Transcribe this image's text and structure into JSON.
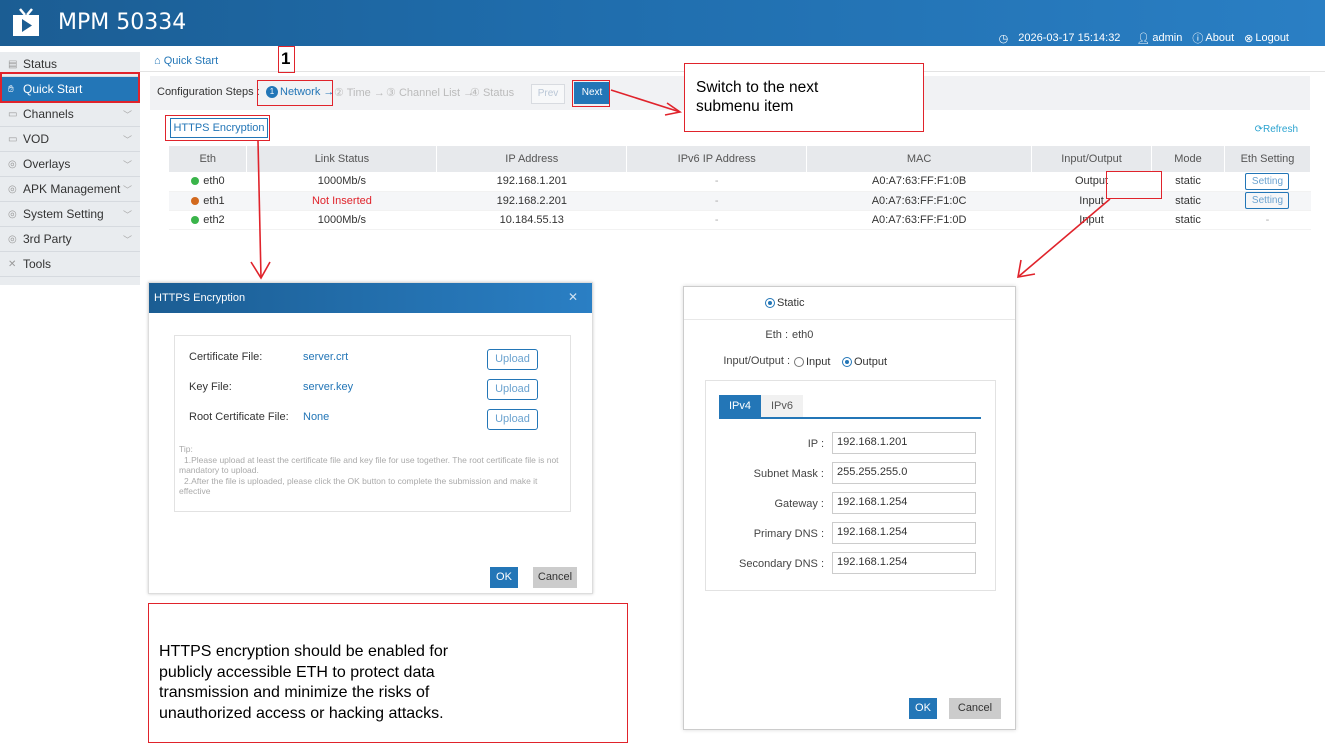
{
  "app": {
    "title": "MPM 50334",
    "datetime": "2026-03-17 15:14:32",
    "user": "admin",
    "about": "About",
    "logout": "Logout"
  },
  "sidebar": {
    "items": [
      {
        "label": "Status",
        "icon": "status-icon"
      },
      {
        "label": "Quick Start",
        "icon": "quickstart-icon"
      },
      {
        "label": "Channels",
        "icon": "channels-icon"
      },
      {
        "label": "VOD",
        "icon": "vod-icon"
      },
      {
        "label": "Overlays",
        "icon": "overlays-icon"
      },
      {
        "label": "APK Management",
        "icon": "apk-icon"
      },
      {
        "label": "System Setting",
        "icon": "gear-icon"
      },
      {
        "label": "3rd Party",
        "icon": "third-party-icon"
      },
      {
        "label": "Tools",
        "icon": "tools-icon"
      }
    ]
  },
  "breadcrumb": "Quick Start",
  "steps": {
    "label": "Configuration Steps :",
    "items": [
      "Network →",
      "Time →",
      "Channel List →",
      "Status"
    ],
    "numbers": [
      "1",
      "②",
      "③",
      "④"
    ],
    "prev": "Prev",
    "next": "Next"
  },
  "https_button": "HTTPS Encryption",
  "refresh": "Refresh",
  "table": {
    "headers": [
      "Eth",
      "Link Status",
      "IP Address",
      "IPv6 IP Address",
      "MAC",
      "Input/Output",
      "Mode",
      "Eth Setting"
    ],
    "rows": [
      {
        "eth": "eth0",
        "status_color": "#3ab44a",
        "link": "1000Mb/s",
        "ip": "192.168.1.201",
        "ipv6": "-",
        "mac": "A0:A7:63:FF:F1:0B",
        "io": "Output",
        "mode": "static",
        "setting": "Setting"
      },
      {
        "eth": "eth1",
        "status_color": "#d2691e",
        "link": "Not Inserted",
        "ip": "192.168.2.201",
        "ipv6": "-",
        "mac": "A0:A7:63:FF:F1:0C",
        "io": "Input",
        "mode": "static",
        "setting": "Setting"
      },
      {
        "eth": "eth2",
        "status_color": "#3ab44a",
        "link": "1000Mb/s",
        "ip": "10.184.55.13",
        "ipv6": "-",
        "mac": "A0:A7:63:FF:F1:0D",
        "io": "Input",
        "mode": "static",
        "setting": "-"
      }
    ]
  },
  "annotations": {
    "step_number": "1",
    "next_callout": [
      "Switch to the next",
      "submenu item"
    ],
    "https_callout": [
      "HTTPS encryption should be enabled for",
      "publicly accessible ETH to protect data",
      "transmission and minimize the risks of",
      "unauthorized access or hacking attacks."
    ],
    "accent_red": "#e0232b"
  },
  "https_dialog": {
    "title": "HTTPS Encryption",
    "rows": [
      {
        "label": "Certificate File:",
        "value": "server.crt",
        "button": "Upload"
      },
      {
        "label": "Key File:",
        "value": "server.key",
        "button": "Upload"
      },
      {
        "label": "Root Certificate File:",
        "value": "None",
        "button": "Upload"
      }
    ],
    "tip": [
      "Tip:",
      "1.Please upload at least the certificate file and key file for use together. The root certificate file is not mandatory to upload.",
      "2.After the file is uploaded, please click the OK button to complete the submission and make it effective"
    ],
    "ok": "OK",
    "cancel": "Cancel"
  },
  "eth_dialog": {
    "mode_option": "Static",
    "eth_label": "Eth :",
    "eth_value": "eth0",
    "io_label": "Input/Output :",
    "io_options": [
      "Input",
      "Output"
    ],
    "io_selected": "Output",
    "tabs": [
      "IPv4",
      "IPv6"
    ],
    "fields": [
      {
        "label": "IP :",
        "value": "192.168.1.201"
      },
      {
        "label": "Subnet Mask :",
        "value": "255.255.255.0"
      },
      {
        "label": "Gateway :",
        "value": "192.168.1.254"
      },
      {
        "label": "Primary DNS :",
        "value": "192.168.1.254"
      },
      {
        "label": "Secondary DNS :",
        "value": "192.168.1.254"
      }
    ],
    "ok": "OK",
    "cancel": "Cancel"
  }
}
